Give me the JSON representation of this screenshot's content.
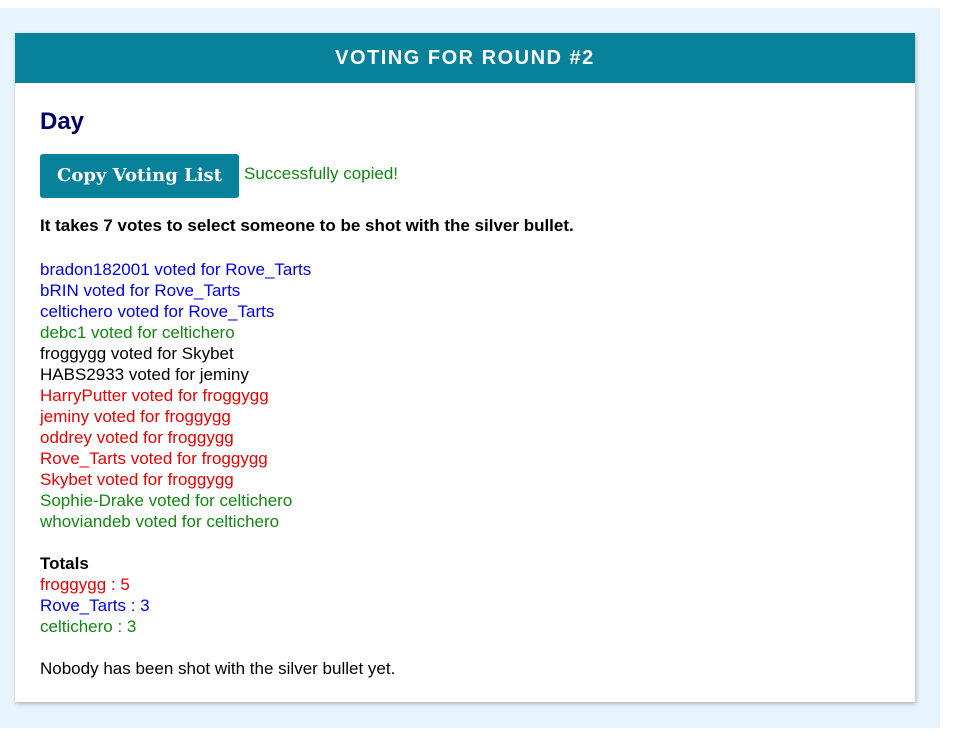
{
  "header": {
    "title": "VOTING FOR ROUND #2"
  },
  "phase": "Day",
  "copy": {
    "button_label": "Copy Voting List",
    "status": "Successfully copied!"
  },
  "rule_text": "It takes 7 votes to select someone to be shot with the silver bullet.",
  "colors": {
    "header_bg": "#08829b",
    "blue": "#0000ee",
    "green": "#118811",
    "black": "#000000",
    "red": "#ee0000",
    "title": "#000066"
  },
  "votes": [
    {
      "text": "bradon182001 voted for Rove_Tarts",
      "color": "#0000ee"
    },
    {
      "text": "bRIN voted for Rove_Tarts",
      "color": "#0000ee"
    },
    {
      "text": "celtichero voted for Rove_Tarts",
      "color": "#0000ee"
    },
    {
      "text": "debc1 voted for celtichero",
      "color": "#118811"
    },
    {
      "text": "froggygg voted for Skybet",
      "color": "#000000"
    },
    {
      "text": "HABS2933 voted for jeminy",
      "color": "#000000"
    },
    {
      "text": "HarryPutter voted for froggygg",
      "color": "#ee0000"
    },
    {
      "text": "jeminy voted for froggygg",
      "color": "#ee0000"
    },
    {
      "text": "oddrey voted for froggygg",
      "color": "#ee0000"
    },
    {
      "text": "Rove_Tarts voted for froggygg",
      "color": "#ee0000"
    },
    {
      "text": "Skybet voted for froggygg",
      "color": "#ee0000"
    },
    {
      "text": "Sophie-Drake voted for celtichero",
      "color": "#118811"
    },
    {
      "text": "whoviandeb voted for celtichero",
      "color": "#118811"
    }
  ],
  "totals": {
    "heading": "Totals",
    "items": [
      {
        "text": "froggygg : 5",
        "color": "#ee0000"
      },
      {
        "text": "Rove_Tarts : 3",
        "color": "#0000ee"
      },
      {
        "text": "celtichero : 3",
        "color": "#118811"
      }
    ]
  },
  "footer_text": "Nobody has been shot with the silver bullet yet."
}
